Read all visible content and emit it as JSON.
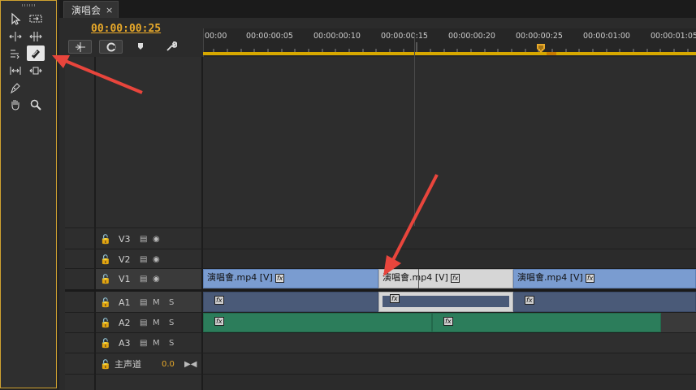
{
  "tab": {
    "title": "演唱会",
    "close": "×"
  },
  "timecode": "00:00:00:25",
  "ruler": {
    "labels": [
      "00:00",
      "00:00:00:05",
      "00:00:00:10",
      "00:00:00:15",
      "00:00:00:20",
      "00:00:00:25",
      "00:00:01:00",
      "00:00:01:05"
    ]
  },
  "toolbar_icons": [
    "snap-icon",
    "linked-selection-icon",
    "marker-icon",
    "wrench-icon"
  ],
  "tools": [
    "selection-tool-icon",
    "track-select-tool-icon",
    "ripple-edit-tool-icon",
    "rolling-edit-tool-icon",
    "rate-stretch-tool-icon",
    "razor-tool-icon",
    "slip-tool-icon",
    "slide-tool-icon",
    "pen-tool-icon",
    "hand-tool-icon",
    "zoom-tool-icon"
  ],
  "tracks": {
    "v3": {
      "name": "V3"
    },
    "v2": {
      "name": "V2"
    },
    "v1": {
      "name": "V1"
    },
    "a1": {
      "name": "A1",
      "m": "M",
      "s": "S"
    },
    "a2": {
      "name": "A2",
      "m": "M",
      "s": "S"
    },
    "a3": {
      "name": "A3",
      "m": "M",
      "s": "S"
    },
    "master": {
      "name": "主声道",
      "value": "0.0"
    }
  },
  "clips": {
    "v1_1": "演唱會.mp4 [V]",
    "v1_2": "演唱會.mp4 [V]",
    "v1_3": "演唱會.mp4 [V]",
    "fx": "fx"
  },
  "colors": {
    "accent": "#d7a800",
    "video_clip": "#7a9cd0",
    "audio_clip_a1": "#4a5a78",
    "audio_clip_a2": "#2c7d5b",
    "annotation_arrow": "#e8453c"
  }
}
